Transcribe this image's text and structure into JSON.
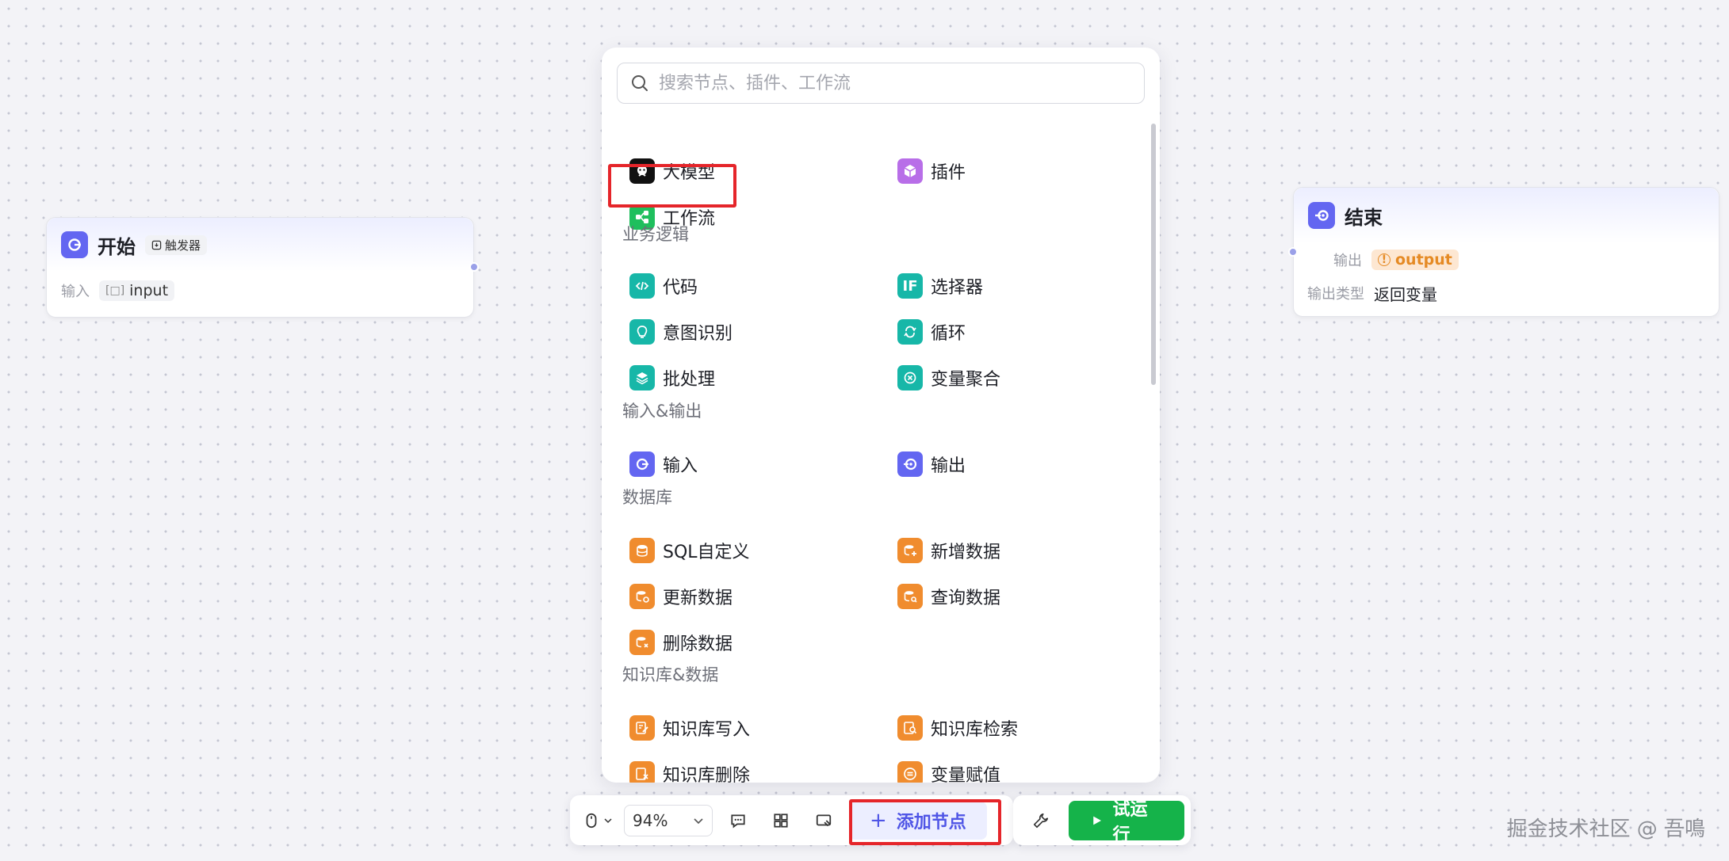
{
  "start_node": {
    "title": "开始",
    "badge": "触发器",
    "input_label": "输入",
    "input_var": "input"
  },
  "end_node": {
    "title": "结束",
    "output_label": "输出",
    "output_var": "output",
    "output_type_label": "输出类型",
    "output_type_value": "返回变量"
  },
  "panel": {
    "search_placeholder": "搜索节点、插件、工作流",
    "top_items": [
      {
        "label": "大模型",
        "icon": "llm-icon",
        "color": "#111111"
      },
      {
        "label": "插件",
        "icon": "plugin-icon",
        "color": "#b86ee8"
      },
      {
        "label": "工作流",
        "icon": "workflow-icon",
        "color": "#1fbf5d"
      }
    ],
    "sections": [
      {
        "title": "业务逻辑",
        "items": [
          {
            "label": "代码",
            "icon": "code-icon"
          },
          {
            "label": "选择器",
            "icon": "if-selector-icon"
          },
          {
            "label": "意图识别",
            "icon": "intent-icon"
          },
          {
            "label": "循环",
            "icon": "loop-icon"
          },
          {
            "label": "批处理",
            "icon": "batch-icon"
          },
          {
            "label": "变量聚合",
            "icon": "variable-merge-icon"
          }
        ]
      },
      {
        "title": "输入&输出",
        "items": [
          {
            "label": "输入",
            "icon": "input-icon"
          },
          {
            "label": "输出",
            "icon": "output-icon"
          }
        ]
      },
      {
        "title": "数据库",
        "items": [
          {
            "label": "SQL自定义",
            "icon": "database-icon"
          },
          {
            "label": "新增数据",
            "icon": "database-add-icon"
          },
          {
            "label": "更新数据",
            "icon": "database-update-icon"
          },
          {
            "label": "查询数据",
            "icon": "database-query-icon"
          },
          {
            "label": "删除数据",
            "icon": "database-delete-icon"
          }
        ]
      },
      {
        "title": "知识库&数据",
        "items": [
          {
            "label": "知识库写入",
            "icon": "kb-write-icon"
          },
          {
            "label": "知识库检索",
            "icon": "kb-search-icon"
          },
          {
            "label": "知识库删除",
            "icon": "kb-delete-icon"
          },
          {
            "label": "变量赋值",
            "icon": "variable-assign-icon"
          }
        ]
      }
    ]
  },
  "toolbar": {
    "zoom": "94%",
    "add_node": "添加节点",
    "test_run": "试运行"
  },
  "watermark": "掘金技术社区 @ 吾鳴",
  "colors": {
    "accent": "#6366f1",
    "run_green": "#15b34a",
    "highlight_red": "#e5252a",
    "orange": "#f08c2e",
    "teal": "#17b7a8"
  }
}
